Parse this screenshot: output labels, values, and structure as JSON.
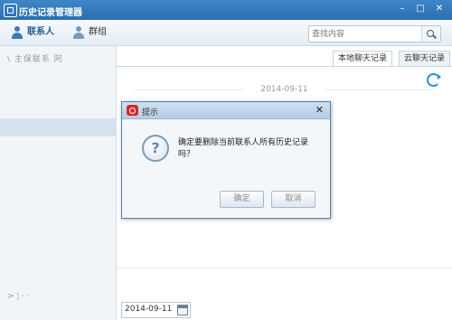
{
  "window": {
    "title": "历史记录管理器",
    "min": "–",
    "max": "□",
    "close": "✕"
  },
  "toolbar": {
    "tabs": [
      {
        "label": "联系人"
      },
      {
        "label": "群组"
      }
    ],
    "search": {
      "placeholder": "查找内容"
    }
  },
  "sidebar": {
    "faded_text": "\\ 主保联系 阿",
    "footer_text": "> ¦ ·  ·"
  },
  "main": {
    "tabs": [
      {
        "label": "本地聊天记录"
      },
      {
        "label": "云聊天记录"
      }
    ],
    "date_separator": "2014-09-11",
    "date_picker": {
      "value": "2014-09-11"
    }
  },
  "dialog": {
    "title": "提示",
    "close": "✕",
    "message": "确定要删除当前联系人所有历史记录吗？",
    "ok_label": "确定",
    "cancel_label": "取消"
  },
  "colors": {
    "title_bar": "#2f78bd",
    "accent": "#3b79b4",
    "dialog_border": "#4f7fb4"
  }
}
